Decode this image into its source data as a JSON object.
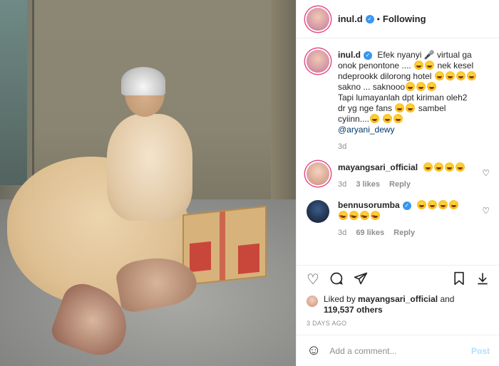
{
  "header": {
    "username": "inul.d",
    "dot": "•",
    "follow_status": "Following"
  },
  "caption": {
    "username": "inul.d",
    "line1": "Efek nyanyi 🎤 virtual ga onok penontone ....",
    "line2": "nek kesel ndeprookk dilorong hotel",
    "line3": "sakno ... saknooo",
    "line4": "Tapi lumayanlah dpt kiriman oleh2 dr yg nge fans",
    "line5": "sambel cyiinn....",
    "mention": "@aryani_dewy",
    "time": "3d"
  },
  "comments": [
    {
      "username": "mayangsari_official",
      "time": "3d",
      "likes": "3 likes",
      "reply": "Reply"
    },
    {
      "username": "bennusorumba",
      "time": "3d",
      "likes": "69 likes",
      "reply": "Reply"
    }
  ],
  "likes": {
    "prefix": "Liked by",
    "user": "mayangsari_official",
    "and": "and",
    "count": "119,537 others"
  },
  "posted_ago": "3 DAYS AGO",
  "add_comment": {
    "placeholder": "Add a comment...",
    "post_label": "Post"
  },
  "icons": [
    "heart-icon",
    "comment-icon",
    "share-icon",
    "bookmark-icon",
    "download-icon",
    "emoji-icon",
    "verified-icon"
  ],
  "colors": {
    "verified": "#3897f0",
    "post_disabled": "#b2dffc",
    "mention": "#00376b"
  }
}
